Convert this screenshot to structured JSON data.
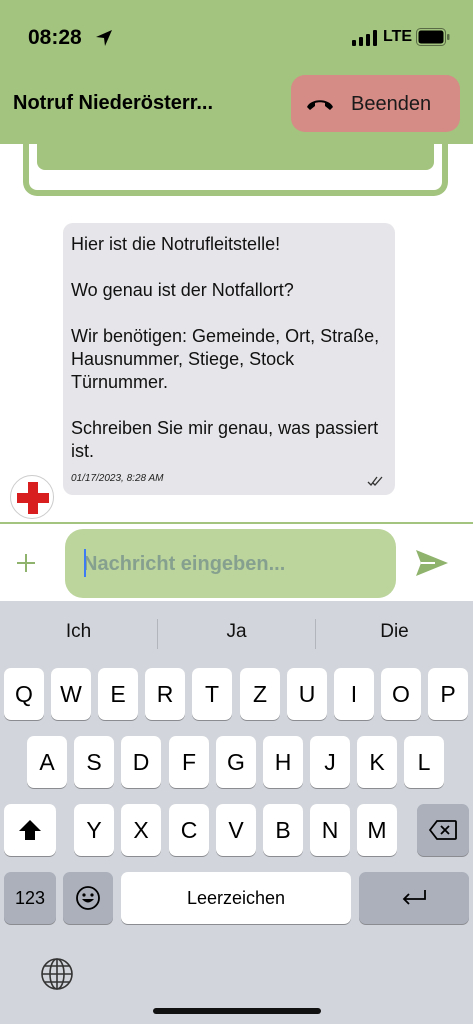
{
  "status": {
    "time": "08:28",
    "network": "LTE"
  },
  "header": {
    "title": "Notruf Niederösterr...",
    "end_button": "Beenden"
  },
  "message": {
    "text": "Hier ist die Notrufleitstelle!\n\nWo genau ist der Notfallort?\n\nWir benötigen: Gemeinde, Ort, Straße, Hausnummer, Stiege, Stock Türnummer.\n\nSchreiben Sie mir genau, was passiert ist.",
    "timestamp": "01/17/2023, 8:28 AM"
  },
  "input": {
    "placeholder": "Nachricht eingeben..."
  },
  "keyboard": {
    "suggestions": [
      "Ich",
      "Ja",
      "Die"
    ],
    "row1": [
      "Q",
      "W",
      "E",
      "R",
      "T",
      "Z",
      "U",
      "I",
      "O",
      "P"
    ],
    "row2": [
      "A",
      "S",
      "D",
      "F",
      "G",
      "H",
      "J",
      "K",
      "L"
    ],
    "row3": [
      "Y",
      "X",
      "C",
      "V",
      "B",
      "N",
      "M"
    ],
    "numbers_key": "123",
    "space_key": "Leerzeichen"
  },
  "colors": {
    "brand_green": "#a3c47e",
    "input_green": "#bcd59c",
    "end_red": "#d58b86",
    "red_cross": "#d81e1e"
  },
  "icons": [
    "location-arrow-icon",
    "signal-icon",
    "battery-icon",
    "phone-hangup-icon",
    "double-check-icon",
    "red-cross-icon",
    "plus-icon",
    "send-icon",
    "shift-icon",
    "backspace-icon",
    "emoji-icon",
    "return-icon",
    "globe-icon"
  ]
}
